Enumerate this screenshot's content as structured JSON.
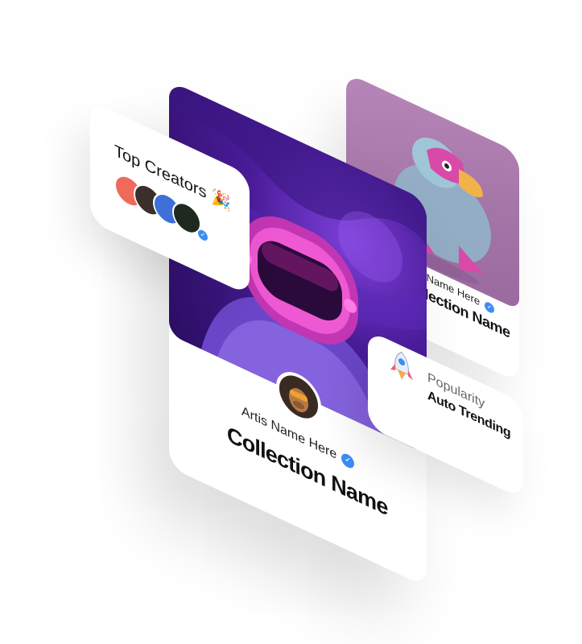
{
  "top_creators": {
    "title": "Top Creators",
    "emoji": "🎉",
    "avatars": [
      "creator-1",
      "creator-2",
      "creator-3",
      "creator-4"
    ]
  },
  "main_card": {
    "artist_name": "Artis Name Here",
    "collection_name": "Collection Name",
    "verified_icon": "verified-badge-icon"
  },
  "back_card": {
    "artist_name": "Artis Name Here",
    "collection_name": "Collection Name",
    "verified_icon": "verified-badge-icon"
  },
  "popularity": {
    "label": "Popularity",
    "value": "Auto Trending",
    "icon": "rocket-icon"
  },
  "colors": {
    "verified": "#3d8df5",
    "main_art_bg": "#4a1c99",
    "back_art_bg": "#a374a6",
    "helmet": "#e94fd0"
  }
}
